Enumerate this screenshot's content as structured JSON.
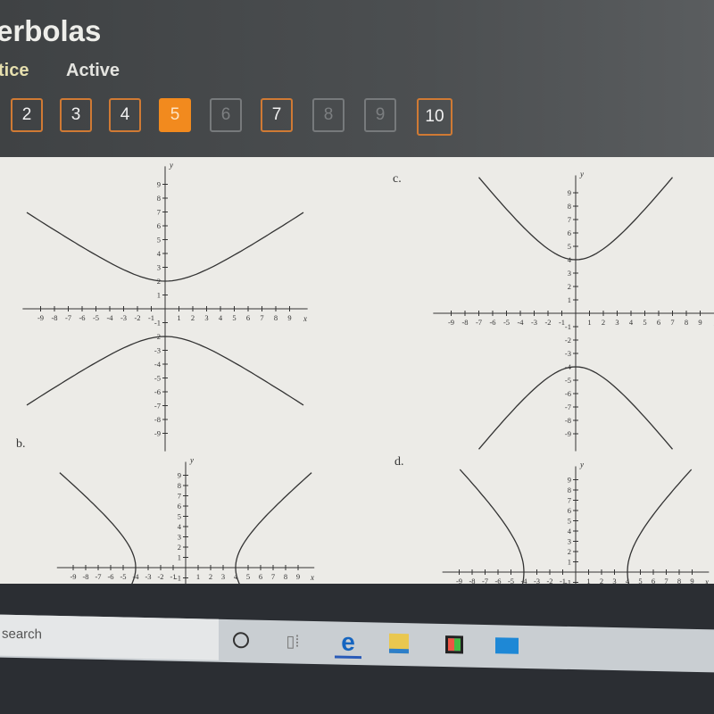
{
  "header": {
    "title": "erbolas",
    "tabs": [
      {
        "label": "tice",
        "state": "practice"
      },
      {
        "label": "Active",
        "state": "active"
      }
    ]
  },
  "questions": [
    {
      "label": "2",
      "state": "answered"
    },
    {
      "label": "3",
      "state": "answered"
    },
    {
      "label": "4",
      "state": "answered"
    },
    {
      "label": "5",
      "state": "current"
    },
    {
      "label": "6",
      "state": "disabled"
    },
    {
      "label": "7",
      "state": "answered"
    },
    {
      "label": "8",
      "state": "disabled"
    },
    {
      "label": "9",
      "state": "disabled"
    },
    {
      "label": "10",
      "state": "answered"
    }
  ],
  "colors": {
    "accent": "#f28a1e",
    "border": "#d07a34",
    "content_bg": "#ecebe7"
  },
  "graphs": [
    {
      "label": "",
      "orientation": "vertical",
      "a": 2,
      "b": 3,
      "x_axis_label": "x",
      "y_axis_label": "y"
    },
    {
      "label": "c.",
      "orientation": "vertical",
      "a": 4,
      "b": 3,
      "x_axis_label": "x",
      "y_axis_label": "y"
    },
    {
      "label": "b.",
      "orientation": "horizontal",
      "a": 4,
      "b": 4,
      "x_axis_label": "x",
      "y_axis_label": "y"
    },
    {
      "label": "d.",
      "orientation": "horizontal",
      "a": 4,
      "b": 5,
      "x_axis_label": "x",
      "y_axis_label": "y"
    }
  ],
  "tick_labels": [
    "-9",
    "-8",
    "-7",
    "-6",
    "-5",
    "-4",
    "-3",
    "-2",
    "-1",
    "1",
    "2",
    "3",
    "4",
    "5",
    "6",
    "7",
    "8",
    "9"
  ],
  "taskbar": {
    "search_placeholder": "search",
    "icons": [
      "cortana-icon",
      "task-view-icon",
      "edge-icon",
      "file-explorer-icon",
      "store-icon",
      "mail-icon"
    ]
  }
}
